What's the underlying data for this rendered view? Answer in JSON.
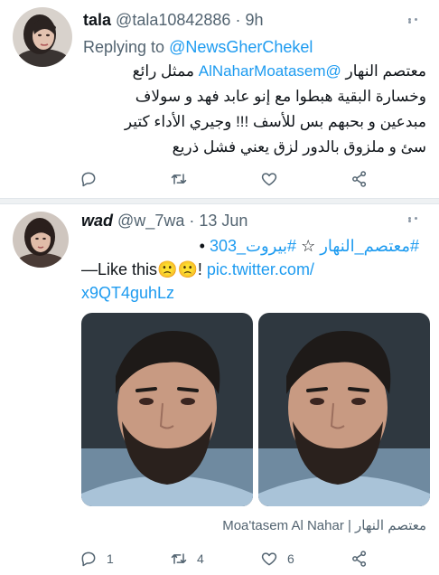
{
  "tweet1": {
    "name": "tala",
    "handle": "@tala10842886",
    "separator": "·",
    "time": "9h",
    "replying_prefix": "Replying to",
    "replying_handle": "@NewsGherChekel",
    "mention": "@AlNaharMoatasem",
    "text_line1_start": "معتصم النهار",
    "text_line1_end": "ممثل رائع",
    "text_line2": "وخسارة البقية هبطوا مع إنو عابد فهد و سولاف",
    "text_line3": "مبدعين و بحبهم بس للأسف !!! وجيري الأداء كتير",
    "text_line4": "سئ و ملزوق بالدور لزق يعني فشل ذريع",
    "actions": {
      "reply_icon": "reply-icon",
      "retweet_icon": "retweet-icon",
      "like_icon": "heart-icon",
      "share_icon": "share-icon"
    }
  },
  "tweet2": {
    "name": "wad",
    "handle": "@w_7wa",
    "separator": "·",
    "time": "13 Jun",
    "hashtag1": "#معتصم_النهار",
    "star": "☆",
    "hashtag2": "#بيروت_303",
    "bullet": "•",
    "text_prefix": "—Like this",
    "emoji": "🙁🙁",
    "exclaim": "!",
    "link_line1": "pic.twitter.com/",
    "link_line2": "x9QT4guhLz",
    "caption": "Moa'tasem Al Nahar | معتصم النهار",
    "reply_count": "1",
    "retweet_count": "4",
    "like_count": "6",
    "actions": {
      "reply_icon": "reply-icon",
      "retweet_icon": "retweet-icon",
      "like_icon": "heart-icon",
      "share_icon": "share-icon"
    }
  },
  "colors": {
    "link": "#1d9bf0",
    "muted": "#536471",
    "text": "#0f1419"
  }
}
